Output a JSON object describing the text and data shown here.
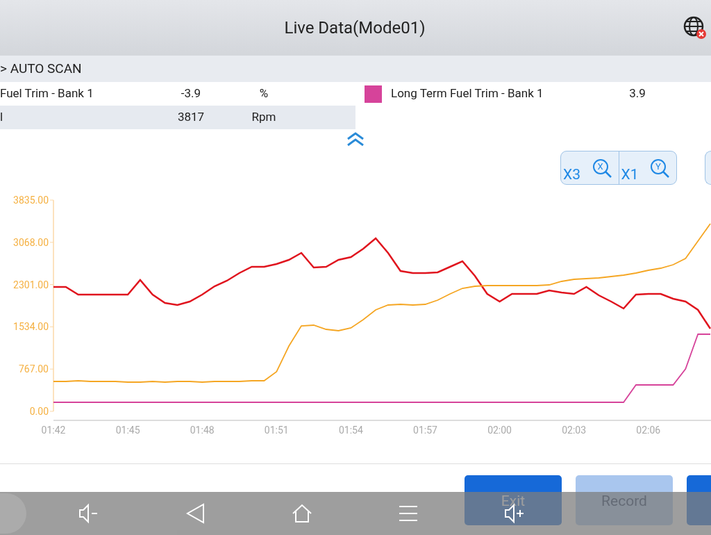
{
  "header": {
    "title": "Live Data(Mode01)"
  },
  "breadcrumb": "> AUTO SCAN",
  "rows": [
    {
      "name": "Fuel Trim - Bank 1",
      "value": "-3.9",
      "unit": "%",
      "shaded": false
    },
    {
      "name": "l",
      "value": "3817",
      "unit": "Rpm",
      "shaded": true
    }
  ],
  "legend": [
    {
      "name": "Long Term Fuel Trim - Bank 1",
      "value": "3.9",
      "color": "#d6439a"
    }
  ],
  "zoom_buttons": [
    {
      "label": "X3",
      "axis": "X"
    },
    {
      "label": "X1",
      "axis": "Y"
    }
  ],
  "chart_data": {
    "type": "line",
    "x": [
      102,
      102.5,
      103,
      103.5,
      104,
      104.5,
      105,
      105.5,
      106,
      106.5,
      107,
      107.5,
      108,
      108.5,
      109,
      109.5,
      110,
      110.5,
      111,
      111.5,
      112,
      112.5,
      113,
      113.5,
      114,
      114.5,
      115,
      115.5,
      116,
      116.5,
      117,
      117.5,
      118,
      118.5,
      119,
      119.5,
      120,
      120.5,
      121,
      121.5,
      122,
      122.5,
      123,
      123.5,
      124,
      124.5,
      125,
      125.5,
      126,
      126.5,
      127,
      127.5,
      128,
      128.5
    ],
    "series": [
      {
        "color": "#e0141e",
        "values": [
          2258,
          2258,
          2119,
          2119,
          2119,
          2119,
          2119,
          2384,
          2119,
          1968,
          1930,
          1993,
          2119,
          2271,
          2372,
          2510,
          2624,
          2624,
          2674,
          2750,
          2876,
          2611,
          2624,
          2750,
          2801,
          2952,
          3141,
          2876,
          2548,
          2510,
          2510,
          2523,
          2624,
          2725,
          2460,
          2132,
          1993,
          2132,
          2132,
          2132,
          2195,
          2157,
          2132,
          2258,
          2107,
          1993,
          1867,
          2119,
          2132,
          2132,
          2044,
          1993,
          1842,
          1501
        ]
      },
      {
        "color": "#f5a623",
        "values": [
          542,
          542,
          555,
          542,
          542,
          542,
          530,
          530,
          542,
          530,
          542,
          542,
          530,
          542,
          542,
          542,
          555,
          555,
          719,
          1186,
          1552,
          1564,
          1489,
          1463,
          1514,
          1665,
          1842,
          1930,
          1943,
          1930,
          1943,
          2018,
          2132,
          2233,
          2271,
          2283,
          2283,
          2283,
          2283,
          2283,
          2296,
          2359,
          2397,
          2409,
          2422,
          2447,
          2473,
          2510,
          2561,
          2599,
          2662,
          2775,
          3091,
          3406
        ]
      },
      {
        "color": "#d6439a",
        "values": [
          164,
          164,
          164,
          164,
          164,
          164,
          164,
          164,
          164,
          164,
          164,
          164,
          164,
          164,
          164,
          164,
          164,
          164,
          164,
          164,
          164,
          164,
          164,
          164,
          164,
          164,
          164,
          164,
          164,
          164,
          164,
          164,
          164,
          164,
          164,
          164,
          164,
          164,
          164,
          164,
          164,
          164,
          164,
          164,
          164,
          164,
          164,
          479,
          479,
          479,
          479,
          770,
          1400,
          1400
        ]
      }
    ],
    "xlim": [
      102,
      128.5
    ],
    "ylim": [
      0,
      3835
    ],
    "xticks": [
      {
        "value": 102,
        "label": "01:42"
      },
      {
        "value": 105,
        "label": "01:45"
      },
      {
        "value": 108,
        "label": "01:48"
      },
      {
        "value": 111,
        "label": "01:51"
      },
      {
        "value": 114,
        "label": "01:54"
      },
      {
        "value": 117,
        "label": "01:57"
      },
      {
        "value": 120,
        "label": "02:00"
      },
      {
        "value": 123,
        "label": "02:03"
      },
      {
        "value": 126,
        "label": "02:06"
      }
    ],
    "yticks": [
      {
        "value": 0,
        "label": "0.00"
      },
      {
        "value": 767,
        "label": "767.00"
      },
      {
        "value": 1534,
        "label": "1534.00"
      },
      {
        "value": 2301,
        "label": "2301.00"
      },
      {
        "value": 3068,
        "label": "3068.00"
      },
      {
        "value": 3835,
        "label": "3835.00"
      }
    ]
  },
  "buttons": [
    {
      "label": "Exit",
      "disabled": false
    },
    {
      "label": "Record",
      "disabled": true
    },
    {
      "disabled": false
    }
  ]
}
